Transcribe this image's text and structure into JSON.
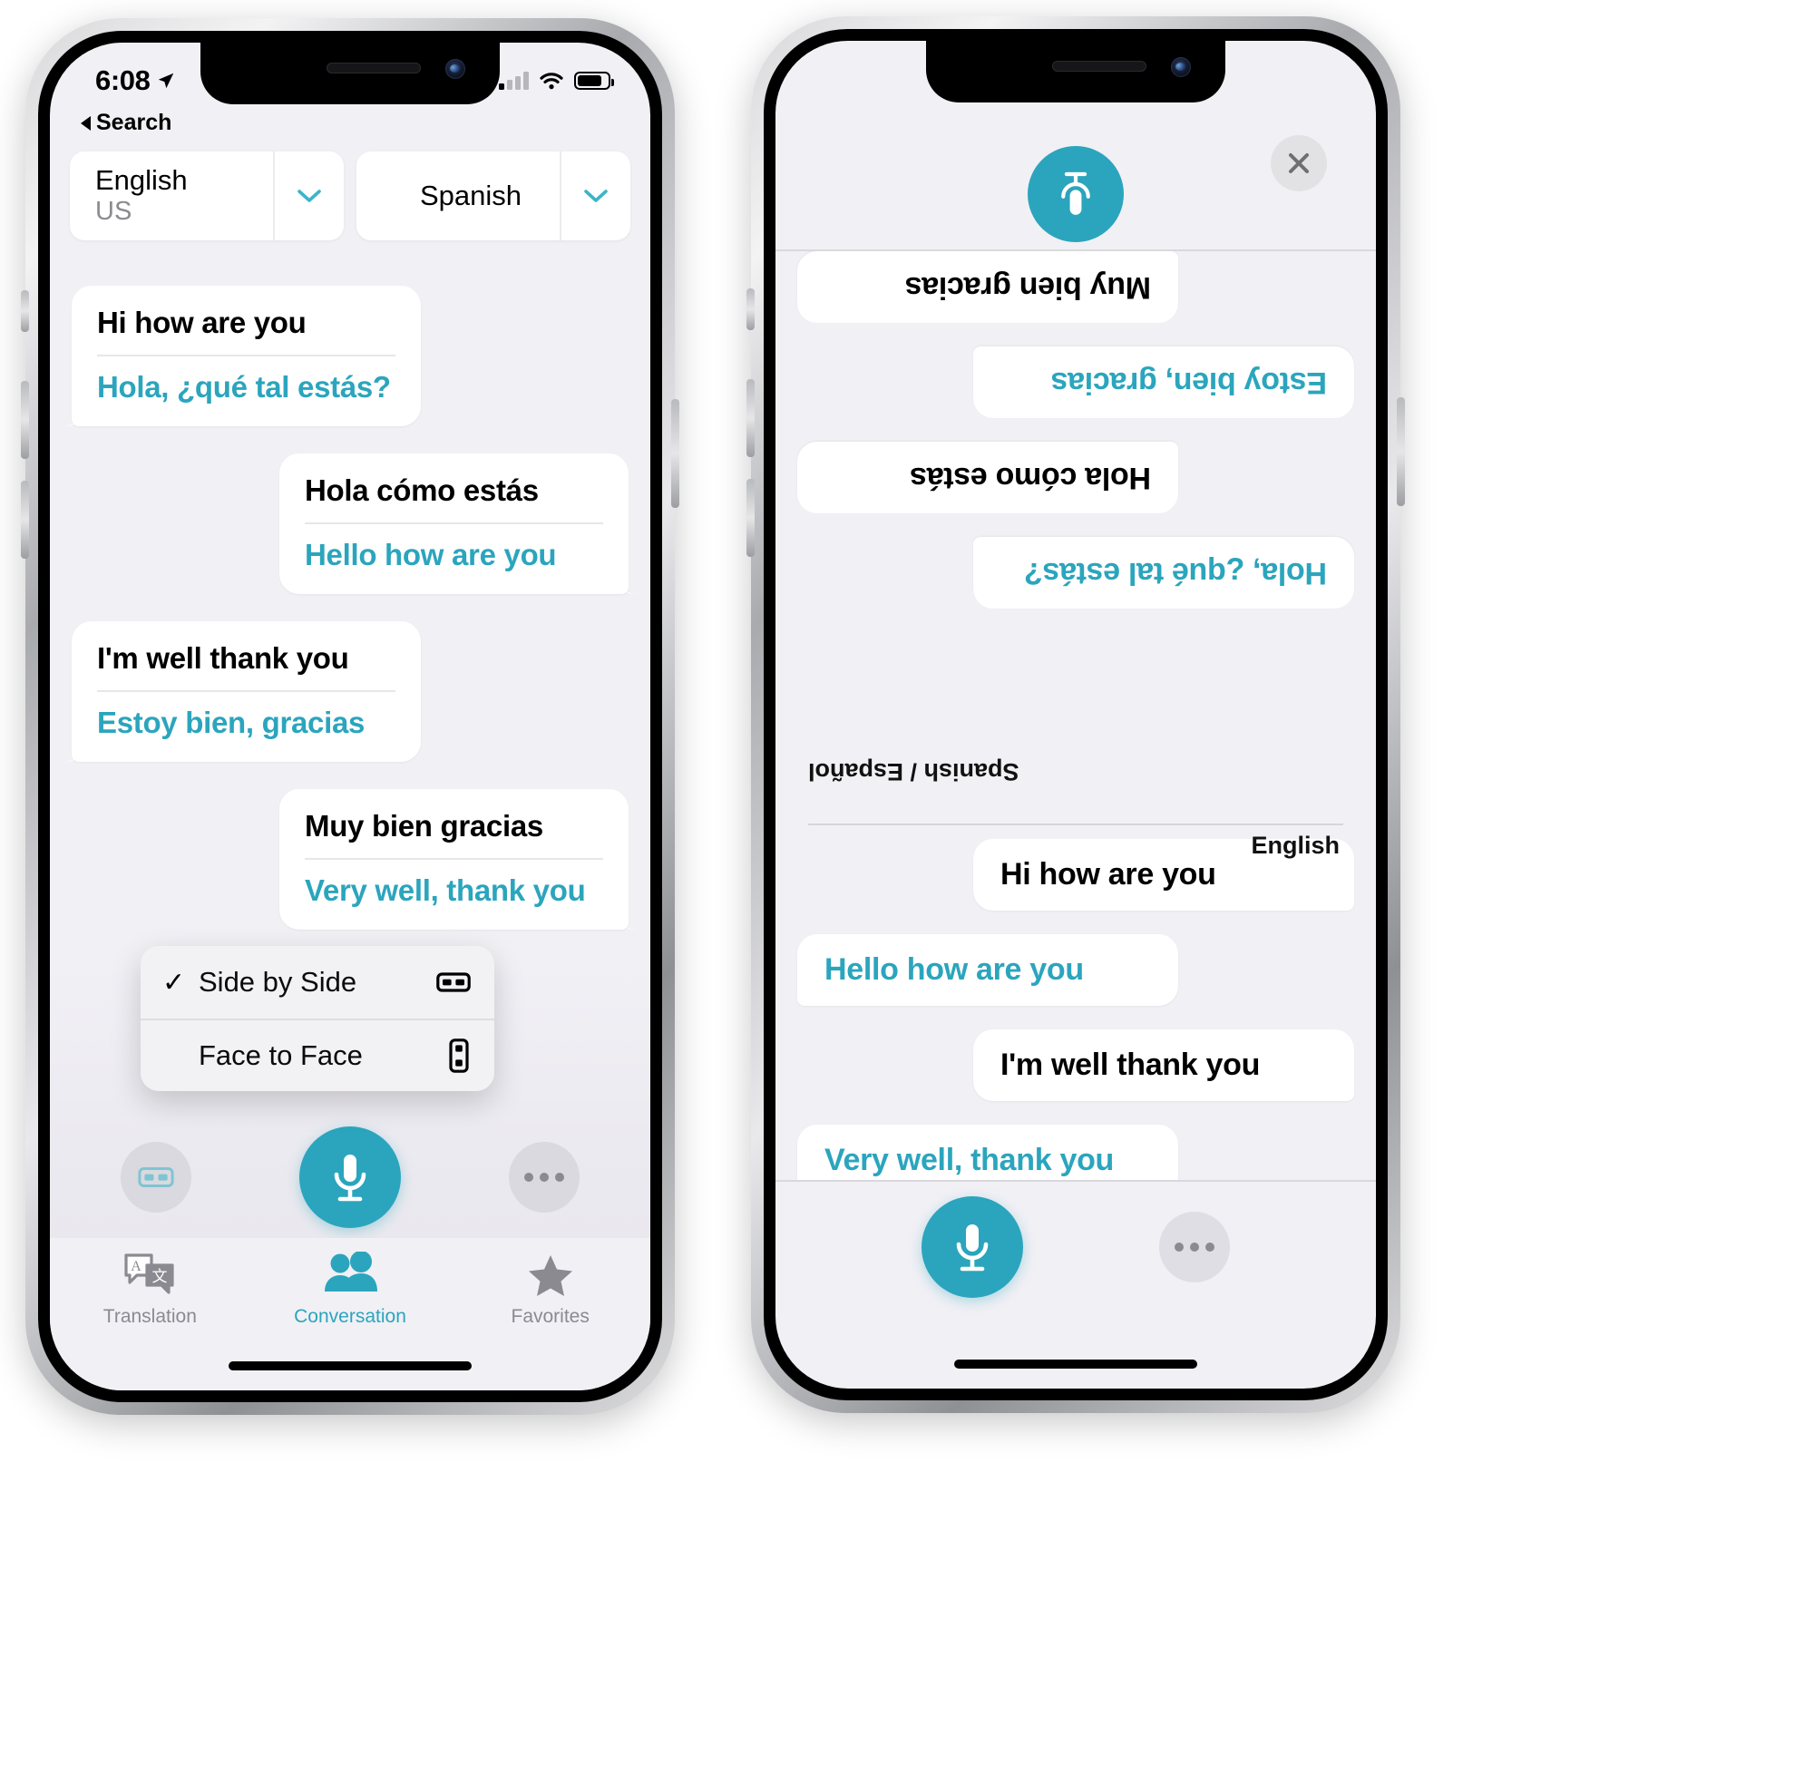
{
  "accent_color": "#2ba5bd",
  "screen_bg": "#f1f0f5",
  "bubble_bg": "#ffffff",
  "left_phone": {
    "status_bar": {
      "time": "6:08",
      "location_icon": "location-arrow-icon",
      "signal_icon": "cellular-signal-icon",
      "wifi_icon": "wifi-icon",
      "battery_icon": "battery-icon"
    },
    "back_nav": {
      "label": "Search",
      "icon": "back-triangle-icon"
    },
    "language_source": {
      "name": "English",
      "region": "US",
      "chevron": "chevron-down-icon"
    },
    "language_target": {
      "name": "Spanish",
      "chevron": "chevron-down-icon"
    },
    "messages": [
      {
        "side": "left",
        "source": "Hi how are you",
        "translation": "Hola, ¿qué tal estás?"
      },
      {
        "side": "right",
        "source": "Hola cómo estás",
        "translation": "Hello how are you"
      },
      {
        "side": "left",
        "source": "I'm well thank you",
        "translation": "Estoy bien, gracias"
      },
      {
        "side": "right",
        "source": "Muy bien gracias",
        "translation": "Very well, thank you"
      }
    ],
    "popup_menu": {
      "items": [
        {
          "label": "Side by Side",
          "checked": "✓",
          "icon": "layout-side-by-side-icon"
        },
        {
          "label": "Face to Face",
          "checked": "",
          "icon": "layout-face-to-face-icon"
        }
      ]
    },
    "action_bar": {
      "layout_button_icon": "layout-side-by-side-icon",
      "mic_button_icon": "microphone-icon",
      "more_button_icon": "ellipsis-icon"
    },
    "tab_bar": {
      "tabs": [
        {
          "label": "Translation",
          "icon": "translate-bubbles-icon",
          "active": false
        },
        {
          "label": "Conversation",
          "icon": "two-people-icon",
          "active": true
        },
        {
          "label": "Favorites",
          "icon": "star-icon",
          "active": false
        }
      ]
    }
  },
  "right_phone": {
    "mic_badge_icon": "microphone-icon",
    "close_button_icon": "close-x-icon",
    "top_messages": [
      {
        "side": "left",
        "text": "Muy bien gracias",
        "kind": "source"
      },
      {
        "side": "right",
        "text": "Estoy bien, gracias",
        "kind": "translation"
      },
      {
        "side": "left",
        "text": "Hola cómo estás",
        "kind": "source"
      },
      {
        "side": "right",
        "text": "Hola, ¿qué tal estás?",
        "kind": "translation"
      }
    ],
    "divider_label_top": "Spanish / Español",
    "divider_label_bottom": "English",
    "bottom_messages": [
      {
        "side": "right",
        "text": "Hi how are you",
        "kind": "source"
      },
      {
        "side": "left",
        "text": "Hello how are you",
        "kind": "translation"
      },
      {
        "side": "right",
        "text": "I'm well thank you",
        "kind": "source"
      },
      {
        "side": "left",
        "text": "Very well, thank you",
        "kind": "translation"
      }
    ],
    "action_bar": {
      "mic_button_icon": "microphone-icon",
      "more_button_icon": "ellipsis-icon"
    }
  }
}
